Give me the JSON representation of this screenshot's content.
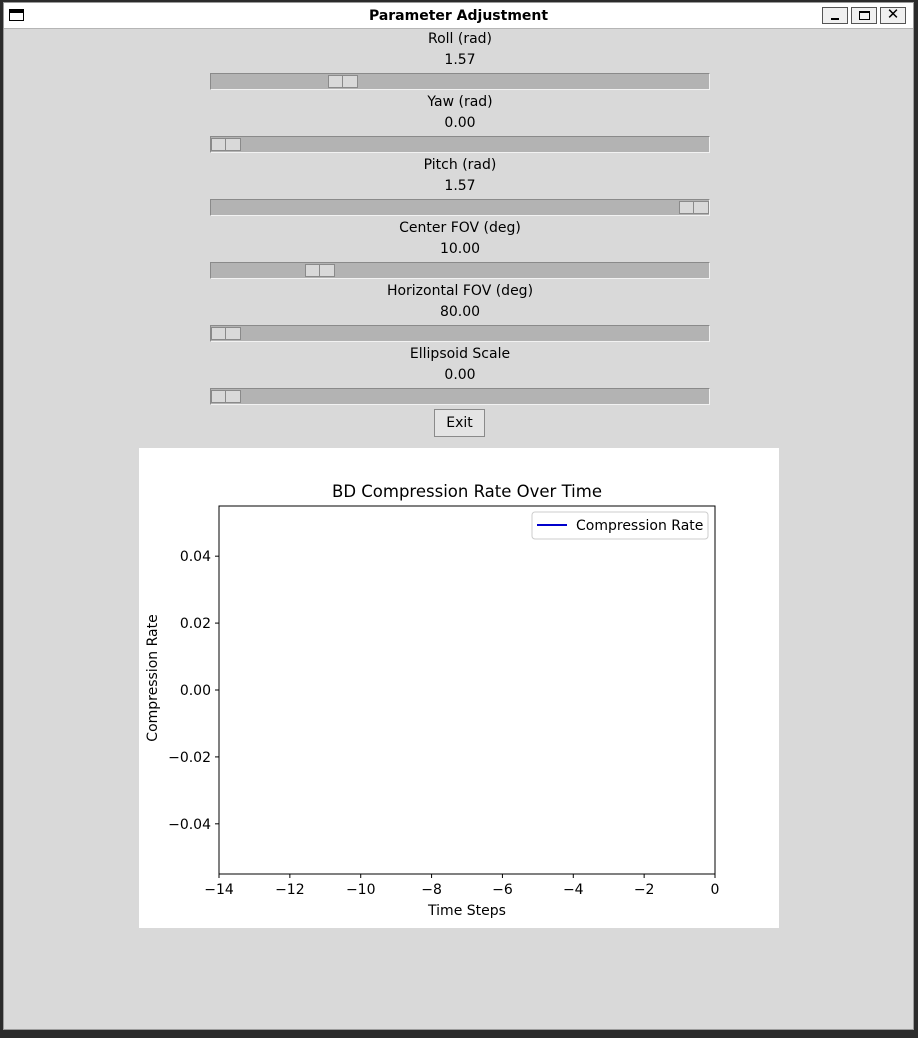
{
  "window": {
    "title": "Parameter Adjustment"
  },
  "params": [
    {
      "label": "Roll (rad)",
      "value": "1.57",
      "min": 0,
      "max": 6.28,
      "current": 1.57
    },
    {
      "label": "Yaw (rad)",
      "value": "0.00",
      "min": 0,
      "max": 6.28,
      "current": 0
    },
    {
      "label": "Pitch (rad)",
      "value": "1.57",
      "min": 0,
      "max": 1.57,
      "current": 1.57
    },
    {
      "label": "Center FOV (deg)",
      "value": "10.00",
      "min": 0,
      "max": 50,
      "current": 10
    },
    {
      "label": "Horizontal FOV (deg)",
      "value": "80.00",
      "min": 80,
      "max": 180,
      "current": 80
    },
    {
      "label": "Ellipsoid Scale",
      "value": "0.00",
      "min": 0,
      "max": 1,
      "current": 0
    }
  ],
  "exit_label": "Exit",
  "chart_data": {
    "type": "line",
    "title": "BD Compression Rate Over Time",
    "xlabel": "Time Steps",
    "ylabel": "Compression Rate",
    "xlim": [
      -14,
      0
    ],
    "ylim": [
      -0.055,
      0.055
    ],
    "xticks": [
      -14,
      -12,
      -10,
      -8,
      -6,
      -4,
      -2,
      0
    ],
    "xtick_labels": [
      "−14",
      "−12",
      "−10",
      "−8",
      "−6",
      "−4",
      "−2",
      "0"
    ],
    "yticks": [
      -0.04,
      -0.02,
      0.0,
      0.02,
      0.04
    ],
    "ytick_labels": [
      "−0.04",
      "−0.02",
      "0.00",
      "0.02",
      "0.04"
    ],
    "legend_position": "top-right",
    "grid": false,
    "series": [
      {
        "name": "Compression Rate",
        "color": "#0000cc",
        "x": [],
        "y": []
      }
    ]
  }
}
